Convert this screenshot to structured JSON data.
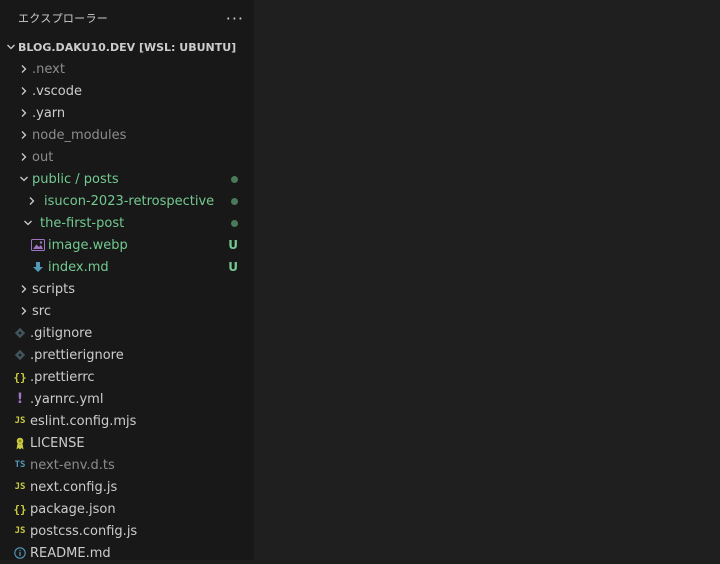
{
  "explorer": {
    "title": "エクスプローラー",
    "more_label": "···",
    "workspace": "BLOG.DAKU10.DEV [WSL: UBUNTU]",
    "items": [
      {
        "label": ".next"
      },
      {
        "label": ".vscode"
      },
      {
        "label": ".yarn"
      },
      {
        "label": "node_modules"
      },
      {
        "label": "out"
      },
      {
        "label": "public / posts"
      },
      {
        "label": "isucon-2023-retrospective"
      },
      {
        "label": "the-first-post"
      },
      {
        "label": "image.webp",
        "status": "U"
      },
      {
        "label": "index.md",
        "status": "U"
      },
      {
        "label": "scripts"
      },
      {
        "label": "src"
      },
      {
        "label": ".gitignore"
      },
      {
        "label": ".prettierignore"
      },
      {
        "label": ".prettierrc"
      },
      {
        "label": ".yarnrc.yml"
      },
      {
        "label": "eslint.config.mjs"
      },
      {
        "label": "LICENSE"
      },
      {
        "label": "next-env.d.ts"
      },
      {
        "label": "next.config.js"
      },
      {
        "label": "package.json"
      },
      {
        "label": "postcss.config.js"
      },
      {
        "label": "README.md"
      }
    ]
  },
  "icons": {
    "js": "JS",
    "ts": "TS",
    "json": "{}",
    "yaml": "!"
  },
  "colors": {
    "sidebar_bg": "#181818",
    "editor_bg": "#1f1f1f",
    "untracked": "#73c991",
    "ignored": "#8c8c8c",
    "modified_dot": "#4b7a5b"
  }
}
